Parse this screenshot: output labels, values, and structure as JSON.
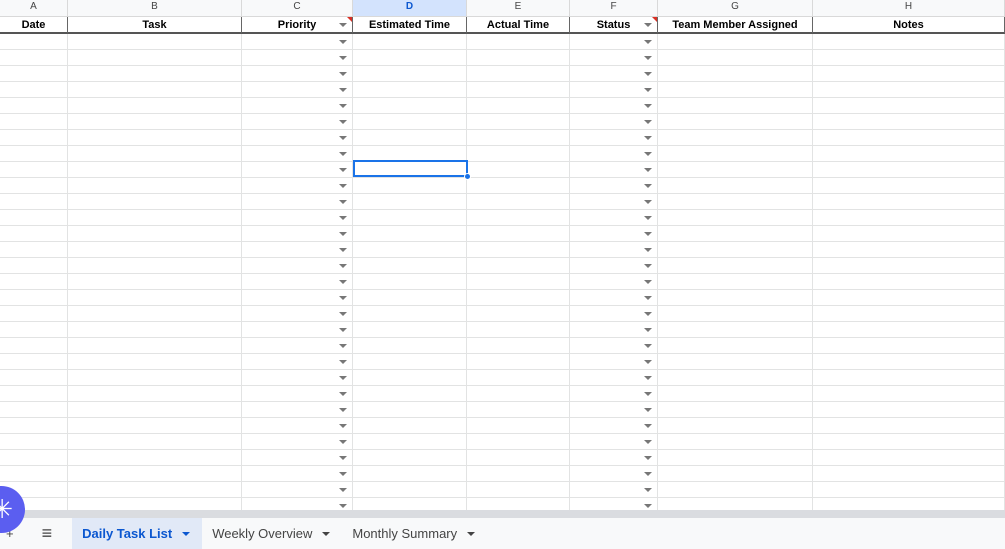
{
  "columns": [
    {
      "letter": "A",
      "header": "Date",
      "dropdown": false,
      "note": false
    },
    {
      "letter": "B",
      "header": "Task",
      "dropdown": false,
      "note": false
    },
    {
      "letter": "C",
      "header": "Priority",
      "dropdown": true,
      "note": true
    },
    {
      "letter": "D",
      "header": "Estimated Time",
      "dropdown": false,
      "note": false
    },
    {
      "letter": "E",
      "header": "Actual Time",
      "dropdown": false,
      "note": false
    },
    {
      "letter": "F",
      "header": "Status",
      "dropdown": true,
      "note": true
    },
    {
      "letter": "G",
      "header": "Team Member Assigned",
      "dropdown": false,
      "note": false
    },
    {
      "letter": "H",
      "header": "Notes",
      "dropdown": false,
      "note": false
    }
  ],
  "selected_column": "D",
  "tabs": {
    "add": "+",
    "menu": "≡",
    "sheets": [
      "Daily Task List",
      "Weekly Overview",
      "Monthly Summary"
    ],
    "active": 0
  },
  "fab_icon": "✳"
}
